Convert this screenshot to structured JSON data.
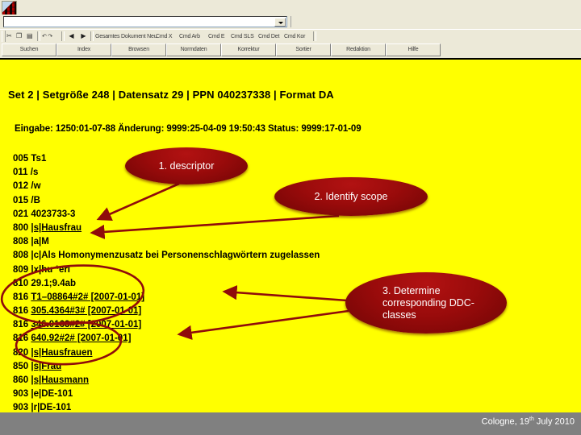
{
  "window": {
    "icon_name": "app-icon",
    "address_value": "",
    "address_placeholder": ""
  },
  "icon_toolbar": {
    "items": [
      {
        "name": "cut-icon",
        "glyph": "✂"
      },
      {
        "name": "copy-icon",
        "glyph": "❐"
      },
      {
        "name": "paste-icon",
        "glyph": "▤"
      },
      {
        "name": "undo-redo-label",
        "glyph": "↶ ↷"
      },
      {
        "name": "prev-record-icon",
        "glyph": "◀"
      },
      {
        "name": "next-record-icon",
        "glyph": "▶"
      }
    ],
    "text_buttons": [
      "Gesamtes Dokument Neu",
      "Cmd X",
      "Cmd Arb",
      "Cmd E",
      "Cmd SLS",
      "Cmd Det",
      "Cmd Kor"
    ]
  },
  "button_row": {
    "buttons": [
      "Suchen",
      "Index",
      "Browsen",
      "Normdaten",
      "Korrektur",
      "Sortier",
      "Redaktion",
      "Hilfe"
    ]
  },
  "slide": {
    "record_header": "Set 2  |  Setgröße 248  |  Datensatz 29  |  PPN 040237338 | Format DA",
    "record_meta": "Eingabe: 1250:01-07-88 Änderung: 9999:25-04-09 19:50:43 Status: 9999:17-01-09",
    "fields": [
      {
        "tag": "005",
        "value": "Ts1",
        "underline": false
      },
      {
        "tag": "011",
        "value": "/s",
        "underline": false
      },
      {
        "tag": "012",
        "value": "/w",
        "underline": false
      },
      {
        "tag": "015",
        "value": "/B",
        "underline": false
      },
      {
        "tag": "021",
        "value": "4023733-3",
        "underline": false
      },
      {
        "tag": "800",
        "value": "|s|Hausfrau",
        "underline": true
      },
      {
        "tag": "808",
        "value": "|a|M",
        "underline": false
      },
      {
        "tag": "808",
        "value": "|c|Als Homonymenzusatz bei Personenschlagwörtern zugelassen",
        "underline": false
      },
      {
        "tag": "809",
        "value": "|x|hu *erl",
        "underline": false
      },
      {
        "tag": "810",
        "value": "29.1;9.4ab",
        "underline": false
      },
      {
        "tag": "816",
        "value": "T1–08864#2# [2007-01-01]",
        "underline": true
      },
      {
        "tag": "816",
        "value": "305.4364#3# [2007-01-01]",
        "underline": true
      },
      {
        "tag": "816",
        "value": "346.0163#2# [2007-01-01]",
        "underline": true
      },
      {
        "tag": "816",
        "value": "640.92#2# [2007-01-01]",
        "underline": true
      },
      {
        "tag": "820",
        "value": "|s|Hausfrauen",
        "underline": true
      },
      {
        "tag": "850",
        "value": "|s|Frau",
        "underline": true
      },
      {
        "tag": "860",
        "value": "|s|Hausmann",
        "underline": true
      },
      {
        "tag": "903",
        "value": "|e|DE-101",
        "underline": false
      },
      {
        "tag": "903",
        "value": "|r|DE-101",
        "underline": false
      }
    ]
  },
  "callouts": [
    {
      "label": "1. descriptor"
    },
    {
      "label": "2. Identify scope"
    },
    {
      "label": "3. Determine corresponding DDC-classes"
    }
  ],
  "footer": {
    "place_date_prefix": "Cologne, 19",
    "ordinal": "th",
    "place_date_suffix": " July 2010"
  },
  "colors": {
    "slide_background": "#ffff00",
    "callout_red": "#9a0b0b",
    "footer_gray": "#808080",
    "chrome": "#ece9d8"
  }
}
